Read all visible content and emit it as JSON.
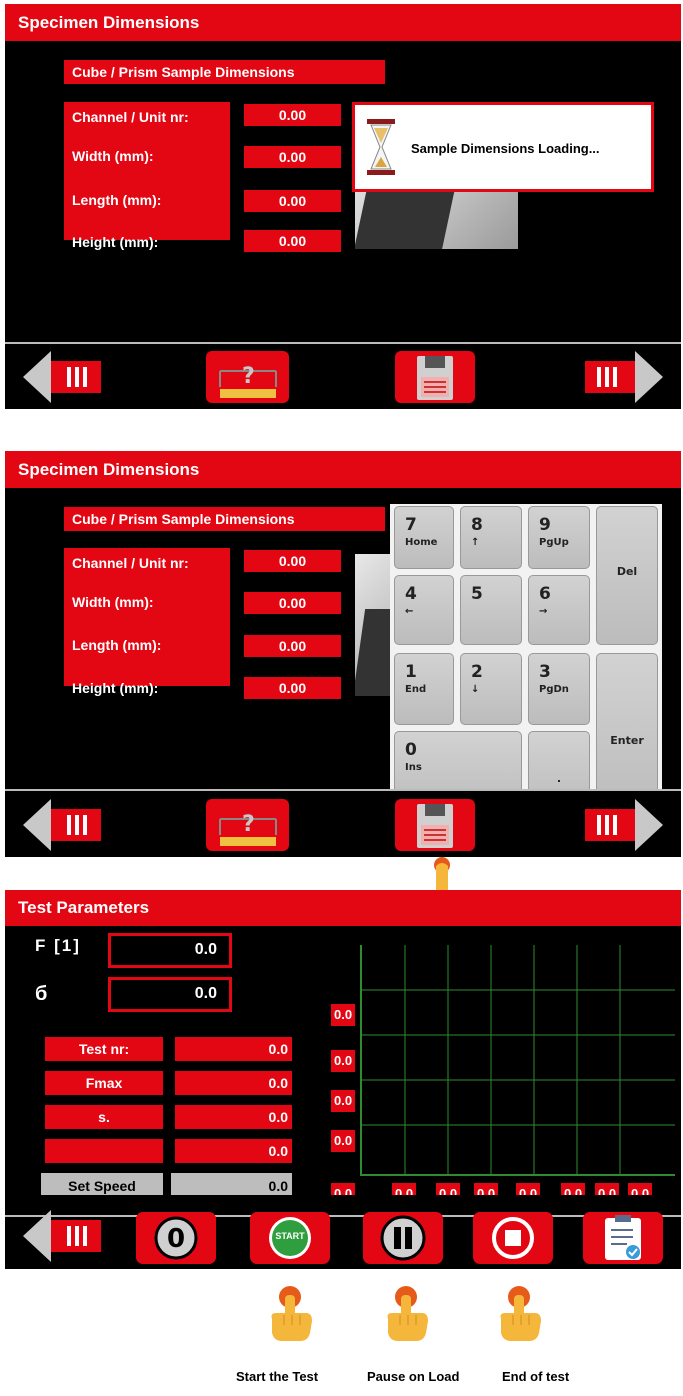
{
  "screen1": {
    "title": "Specimen Dimensions",
    "section_header": "Cube / Prism Sample Dimensions",
    "fields": [
      {
        "label": "Channel / Unit nr:",
        "value": "0.00"
      },
      {
        "label": "Width (mm):",
        "value": "0.00"
      },
      {
        "label": "Length (mm):",
        "value": "0.00"
      },
      {
        "label": "Height (mm):",
        "value": "0.00"
      }
    ],
    "popup_text": "Sample Dimensions Loading..."
  },
  "screen2": {
    "title": "Specimen Dimensions",
    "section_header": "Cube / Prism Sample Dimensions",
    "fields": [
      {
        "label": "Channel / Unit nr:",
        "value": "0.00"
      },
      {
        "label": "Width (mm):",
        "value": "0.00"
      },
      {
        "label": "Length (mm):",
        "value": "0.00"
      },
      {
        "label": "Height (mm):",
        "value": "0.00"
      }
    ],
    "keypad": {
      "k7": {
        "main": "7",
        "sub": "Home"
      },
      "k8": {
        "main": "8",
        "sub": "↑"
      },
      "k9": {
        "main": "9",
        "sub": "PgUp"
      },
      "k4": {
        "main": "4",
        "sub": "←"
      },
      "k5": {
        "main": "5",
        "sub": ""
      },
      "k6": {
        "main": "6",
        "sub": "→"
      },
      "k1": {
        "main": "1",
        "sub": "End"
      },
      "k2": {
        "main": "2",
        "sub": "↓"
      },
      "k3": {
        "main": "3",
        "sub": "PgDn"
      },
      "k0": {
        "main": "0",
        "sub": "Ins"
      },
      "dot": ".",
      "del": "Del",
      "enter": "Enter"
    }
  },
  "screen3": {
    "title": "Test Parameters",
    "force_label": "F [1]",
    "force_value": "0.0",
    "stress_label": "б",
    "stress_value": "0.0",
    "params": [
      {
        "label": "Test nr:",
        "value": "0.0"
      },
      {
        "label": "Fmax",
        "value": "0.0"
      },
      {
        "label": "s.",
        "value": "0.0"
      },
      {
        "label": "",
        "value": "0.0"
      }
    ],
    "speed": {
      "label": "Set Speed",
      "value": "0.0"
    },
    "y_ticks": [
      "0.0",
      "0.0",
      "0.0",
      "0.0"
    ],
    "x_ticks": [
      "0.0",
      "0.0",
      "0.0",
      "0.0",
      "0.0",
      "0.0",
      "0.0"
    ],
    "origin_tick": "0.0",
    "start_label": "START"
  },
  "captions": {
    "start": "Start the Test",
    "pause": "Pause on Load",
    "end": "End of test"
  },
  "colors": {
    "accent": "#e30613",
    "background": "#000000",
    "grid": "#2e8b2e",
    "start_green": "#2e9e3e"
  },
  "icons": [
    "back-arrow-icon",
    "forward-arrow-icon",
    "help-ruler-icon",
    "floppy-save-icon",
    "hourglass-icon",
    "zero-icon",
    "start-icon",
    "pause-icon",
    "stop-icon",
    "report-icon",
    "pointing-hand-icon"
  ]
}
